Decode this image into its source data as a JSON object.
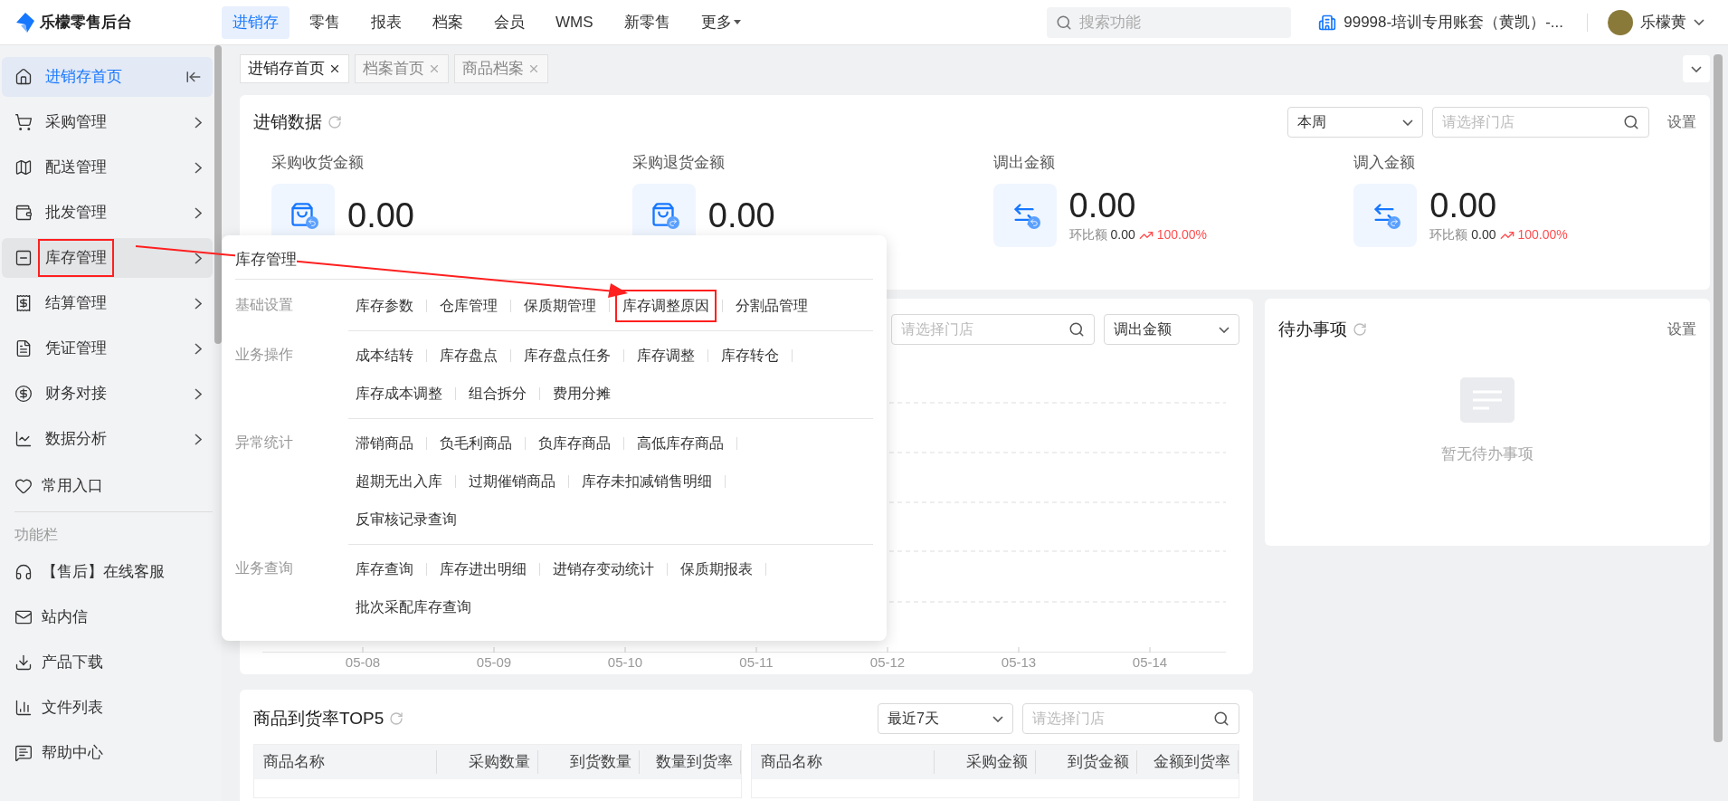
{
  "topbar": {
    "logo": "乐檬零售后台",
    "nav": [
      {
        "label": "进销存",
        "selected": true,
        "dropdown": false
      },
      {
        "label": "零售",
        "selected": false,
        "dropdown": false
      },
      {
        "label": "报表",
        "selected": false,
        "dropdown": false
      },
      {
        "label": "档案",
        "selected": false,
        "dropdown": false
      },
      {
        "label": "会员",
        "selected": false,
        "dropdown": false
      },
      {
        "label": "WMS",
        "selected": false,
        "dropdown": false
      },
      {
        "label": "新零售",
        "selected": false,
        "dropdown": false
      },
      {
        "label": "更多",
        "selected": false,
        "dropdown": true
      }
    ],
    "search": {
      "placeholder": "搜索功能"
    },
    "account": "99998-培训专用账套（黄凯）-...",
    "user": "乐檬黄"
  },
  "sidebar": {
    "items": [
      {
        "label": "进销存首页",
        "selected": true,
        "expandable": false,
        "highlighted": false
      },
      {
        "label": "采购管理",
        "selected": false,
        "expandable": true,
        "highlighted": false
      },
      {
        "label": "配送管理",
        "selected": false,
        "expandable": true,
        "highlighted": false
      },
      {
        "label": "批发管理",
        "selected": false,
        "expandable": true,
        "highlighted": false
      },
      {
        "label": "库存管理",
        "selected": false,
        "expandable": true,
        "highlighted": true
      },
      {
        "label": "结算管理",
        "selected": false,
        "expandable": true,
        "highlighted": false
      },
      {
        "label": "凭证管理",
        "selected": false,
        "expandable": true,
        "highlighted": false
      },
      {
        "label": "财务对接",
        "selected": false,
        "expandable": true,
        "highlighted": false
      },
      {
        "label": "数据分析",
        "selected": false,
        "expandable": true,
        "highlighted": false
      }
    ],
    "favorites": "常用入口",
    "section_title": "功能栏",
    "tools": [
      "【售后】在线客服",
      "站内信",
      "产品下载",
      "文件列表",
      "帮助中心"
    ]
  },
  "tabs": [
    {
      "label": "进销存首页",
      "selected": true
    },
    {
      "label": "档案首页",
      "selected": false
    },
    {
      "label": "商品档案",
      "selected": false
    }
  ],
  "overview": {
    "title": "进销数据",
    "period": "本周",
    "store": {
      "placeholder": "请选择门店"
    },
    "settings": "设置",
    "metrics": [
      {
        "label": "采购收货金额",
        "value": "0.00"
      },
      {
        "label": "采购退货金额",
        "value": "0.00"
      },
      {
        "label": "调出金额",
        "value": "0.00",
        "compare": {
          "label": "环比额",
          "value": "0.00",
          "change": "100.00%"
        }
      },
      {
        "label": "调入金额",
        "value": "0.00",
        "compare": {
          "label": "环比额",
          "value": "0.00",
          "change": "100.00%"
        }
      }
    ]
  },
  "trend": {
    "store": {
      "placeholder": "请选择门店"
    },
    "measure": "调出金额",
    "x_labels": [
      "05-08",
      "05-09",
      "05-10",
      "05-11",
      "05-12",
      "05-13",
      "05-14"
    ]
  },
  "todo": {
    "title": "待办事项",
    "settings": "设置",
    "empty": "暂无待办事项"
  },
  "top5": {
    "title": "商品到货率TOP5",
    "period": "最近7天",
    "store": {
      "placeholder": "请选择门店"
    },
    "tables": [
      {
        "columns": [
          "商品名称",
          "采购数量",
          "到货数量",
          "数量到货率"
        ]
      },
      {
        "columns": [
          "商品名称",
          "采购金额",
          "到货金额",
          "金额到货率"
        ]
      }
    ]
  },
  "flyout": {
    "title": "库存管理",
    "sections": [
      {
        "label": "基础设置",
        "lines": [
          [
            {
              "label": "库存参数",
              "highlighted": false
            },
            {
              "label": "仓库管理",
              "highlighted": false
            },
            {
              "label": "保质期管理",
              "highlighted": false
            },
            {
              "label": "库存调整原因",
              "highlighted": true
            },
            {
              "label": "分割品管理",
              "highlighted": false
            }
          ]
        ]
      },
      {
        "label": "业务操作",
        "lines": [
          [
            {
              "label": "成本结转",
              "highlighted": false
            },
            {
              "label": "库存盘点",
              "highlighted": false
            },
            {
              "label": "库存盘点任务",
              "highlighted": false
            },
            {
              "label": "库存调整",
              "highlighted": false
            },
            {
              "label": "库存转仓",
              "highlighted": false
            }
          ],
          [
            {
              "label": "库存成本调整",
              "highlighted": false
            },
            {
              "label": "组合拆分",
              "highlighted": false
            },
            {
              "label": "费用分摊",
              "highlighted": false
            }
          ]
        ]
      },
      {
        "label": "异常统计",
        "lines": [
          [
            {
              "label": "滞销商品",
              "highlighted": false
            },
            {
              "label": "负毛利商品",
              "highlighted": false
            },
            {
              "label": "负库存商品",
              "highlighted": false
            },
            {
              "label": "高低库存商品",
              "highlighted": false
            }
          ],
          [
            {
              "label": "超期无出入库",
              "highlighted": false
            },
            {
              "label": "过期催销商品",
              "highlighted": false
            },
            {
              "label": "库存未扣减销售明细",
              "highlighted": false
            }
          ],
          [
            {
              "label": "反审核记录查询",
              "highlighted": false
            }
          ]
        ]
      },
      {
        "label": "业务查询",
        "lines": [
          [
            {
              "label": "库存查询",
              "highlighted": false
            },
            {
              "label": "库存进出明细",
              "highlighted": false
            },
            {
              "label": "进销存变动统计",
              "highlighted": false
            },
            {
              "label": "保质期报表",
              "highlighted": false
            }
          ],
          [
            {
              "label": "批次采配库存查询",
              "highlighted": false
            }
          ]
        ]
      }
    ]
  }
}
